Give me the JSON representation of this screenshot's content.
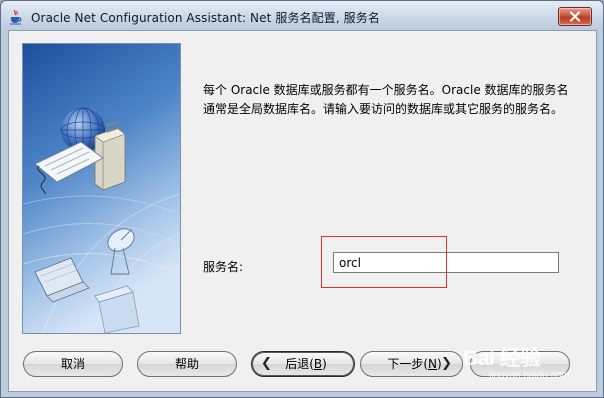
{
  "window": {
    "title": "Oracle Net Configuration Assistant: Net 服务名配置, 服务名"
  },
  "content": {
    "description": "每个 Oracle 数据库或服务都有一个服务名。Oracle 数据库的服务名通常是全局数据库名。请输入要访问的数据库或其它服务的服务名。",
    "service_name_label": "服务名:",
    "service_name_value": "orcl"
  },
  "buttons": {
    "cancel": "取消",
    "help": "帮助",
    "back_text": "后退(",
    "back_key": "B",
    "back_end": ")",
    "next_text": "下一步(",
    "next_key": "N",
    "next_end": ")"
  },
  "watermark": {
    "logo": "Bai 经验",
    "url": "jingyan.baidu.com"
  },
  "colors": {
    "highlight_box": "#e03030",
    "close_button": "#c8553a",
    "art_background": "#3a6fb0"
  },
  "icons": {
    "title": "java-coffee-icon",
    "close": "close-icon",
    "back": "chevron-left-icon",
    "next": "chevron-right-icon"
  }
}
